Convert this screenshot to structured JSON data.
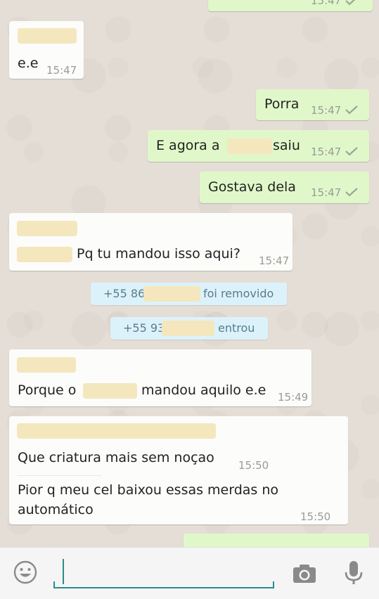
{
  "messages": {
    "m1_time": "15:47",
    "m2_text": "e.e",
    "m2_time": "15:47",
    "m3_text": "Porra",
    "m3_time": "15:47",
    "m4_text_a": "E agora a",
    "m4_text_b": "saiu",
    "m4_time": "15:47",
    "m5_text": "Gostava dela",
    "m5_time": "15:47",
    "m6_text": "Pq tu mandou isso aqui?",
    "m6_time": "15:47",
    "sys1_prefix": "+55 86",
    "sys1_suffix": "foi removido",
    "sys2_prefix": "+55 93",
    "sys2_suffix": "entrou",
    "m7_text_a": "Porque o",
    "m7_text_b": "mandou aquilo e.e",
    "m7_time": "15:49",
    "m8_text": "Que criatura mais sem noçao",
    "m8_time": "15:50",
    "m9_line1": "Pior q meu cel baixou essas merdas no",
    "m9_line2": "automático",
    "m9_time": "15:50"
  },
  "icons": {
    "emoji": "emoji-icon",
    "camera": "camera-icon",
    "mic": "microphone-icon",
    "check": "single-check-icon"
  },
  "colors": {
    "outgoing_bubble": "#e0f8c9",
    "incoming_bubble": "#fcfcfa",
    "system_bubble": "#dcf2fb",
    "accent": "#2e8b8b",
    "redaction": "#f4e7bd"
  }
}
